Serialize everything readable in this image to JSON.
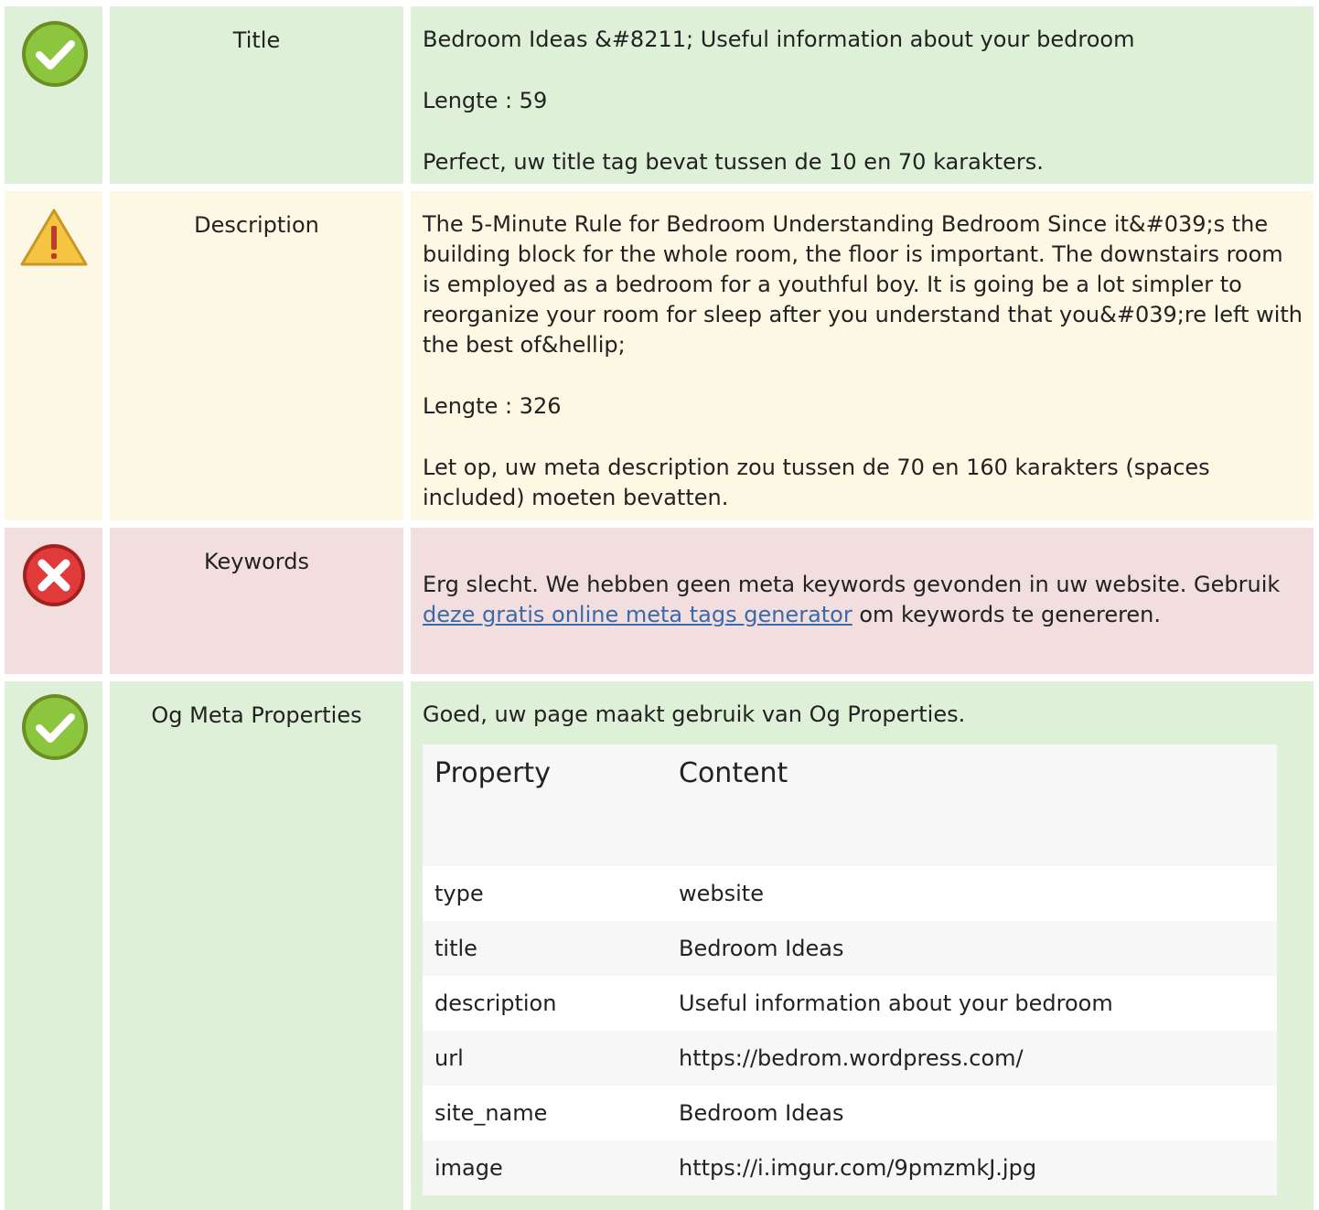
{
  "colors": {
    "good": "#dff0d8",
    "warning": "#fcf8e3",
    "bad": "#f2dede",
    "link": "#3a6aa8"
  },
  "rows": [
    {
      "status": "good",
      "icon": "check-circle-icon",
      "label": "Title",
      "value": "Bedroom Ideas &#8211; Useful information about your bedroom",
      "length": "Lengte : 59",
      "message": "Perfect, uw title tag bevat tussen de 10 en 70 karakters."
    },
    {
      "status": "warning",
      "icon": "warning-triangle-icon",
      "label": "Description",
      "value": "The 5-Minute Rule for Bedroom Understanding Bedroom Since it&#039;s the building block for the whole room, the floor is important. The downstairs room is employed as a bedroom for a youthful boy. It is going be a lot simpler to reorganize your room for sleep after you understand that you&#039;re left with the best of&hellip;",
      "length": "Lengte : 326",
      "message": "Let op, uw meta description zou tussen de 70 en 160 karakters (spaces included) moeten bevatten."
    },
    {
      "status": "bad",
      "icon": "error-x-icon",
      "label": "Keywords",
      "message_before": "Erg slecht. We hebben geen meta keywords gevonden in uw website. Gebruik ",
      "link_text": "deze gratis online meta tags generator",
      "message_after": " om keywords te genereren."
    },
    {
      "status": "good",
      "icon": "check-circle-icon",
      "label": "Og Meta Properties",
      "message": "Goed, uw page maakt gebruik van Og Properties.",
      "table": {
        "headers": [
          "Property",
          "Content"
        ],
        "rows": [
          [
            "type",
            "website"
          ],
          [
            "title",
            "Bedroom Ideas"
          ],
          [
            "description",
            "Useful information about your bedroom"
          ],
          [
            "url",
            "https://bedrom.wordpress.com/"
          ],
          [
            "site_name",
            "Bedroom Ideas"
          ],
          [
            "image",
            "https://i.imgur.com/9pmzmkJ.jpg"
          ]
        ]
      }
    }
  ]
}
